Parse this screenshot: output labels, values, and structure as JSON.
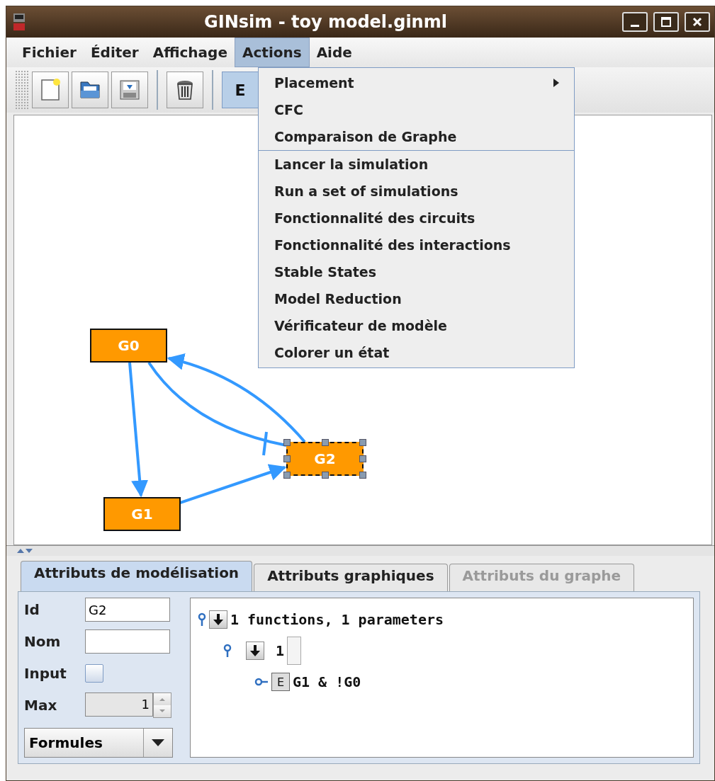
{
  "window": {
    "title": "GINsim - toy model.ginml"
  },
  "menubar": [
    {
      "label": "Fichier",
      "selected": false
    },
    {
      "label": "Éditer",
      "selected": false
    },
    {
      "label": "Affichage",
      "selected": false
    },
    {
      "label": "Actions",
      "selected": true
    },
    {
      "label": "Aide",
      "selected": false
    }
  ],
  "toolbar": {
    "edit_mode": {
      "label": "E",
      "selected": true
    }
  },
  "actions_menu": [
    {
      "label": "Placement",
      "kind": "submenu",
      "separator_before": false
    },
    {
      "label": "CFC",
      "kind": "item",
      "separator_before": false
    },
    {
      "label": "Comparaison de Graphe",
      "kind": "item",
      "separator_before": false
    },
    {
      "label": "Lancer la simulation",
      "kind": "item",
      "separator_before": true
    },
    {
      "label": "Run a set of simulations",
      "kind": "item",
      "separator_before": false
    },
    {
      "label": "Fonctionnalité des circuits",
      "kind": "item",
      "separator_before": false
    },
    {
      "label": "Fonctionnalité des interactions",
      "kind": "item",
      "separator_before": false
    },
    {
      "label": "Stable States",
      "kind": "item",
      "separator_before": false
    },
    {
      "label": "Model Reduction",
      "kind": "item",
      "separator_before": false
    },
    {
      "label": "Vérificateur de modèle",
      "kind": "item",
      "separator_before": false
    },
    {
      "label": "Colorer un état",
      "kind": "item",
      "separator_before": false
    }
  ],
  "graph": {
    "nodes": [
      {
        "label": "G0",
        "selected": false
      },
      {
        "label": "G1",
        "selected": false
      },
      {
        "label": "G2",
        "selected": true
      }
    ],
    "edges": [
      {
        "kind": "activation"
      },
      {
        "kind": "activation"
      },
      {
        "kind": "activation"
      },
      {
        "kind": "inhibition"
      }
    ]
  },
  "tabs": [
    {
      "label": "Attributs de modélisation",
      "selected": true,
      "disabled": false
    },
    {
      "label": "Attributs graphiques",
      "selected": false,
      "disabled": false
    },
    {
      "label": "Attributs du graphe",
      "selected": false,
      "disabled": true
    }
  ],
  "form": {
    "id": {
      "label": "Id",
      "value": "G2"
    },
    "nom": {
      "label": "Nom"
    },
    "input": {
      "label": "Input",
      "checked": false
    },
    "max": {
      "label": "Max",
      "value": "1"
    },
    "view": {
      "value": "Formules"
    }
  },
  "tree": {
    "label": "1 functions, 1 parameters",
    "expanded": true,
    "children": [
      {
        "label": "1",
        "expanded": true,
        "children": [
          {
            "badge": "E",
            "label": "G1 & !G0"
          }
        ]
      }
    ]
  }
}
